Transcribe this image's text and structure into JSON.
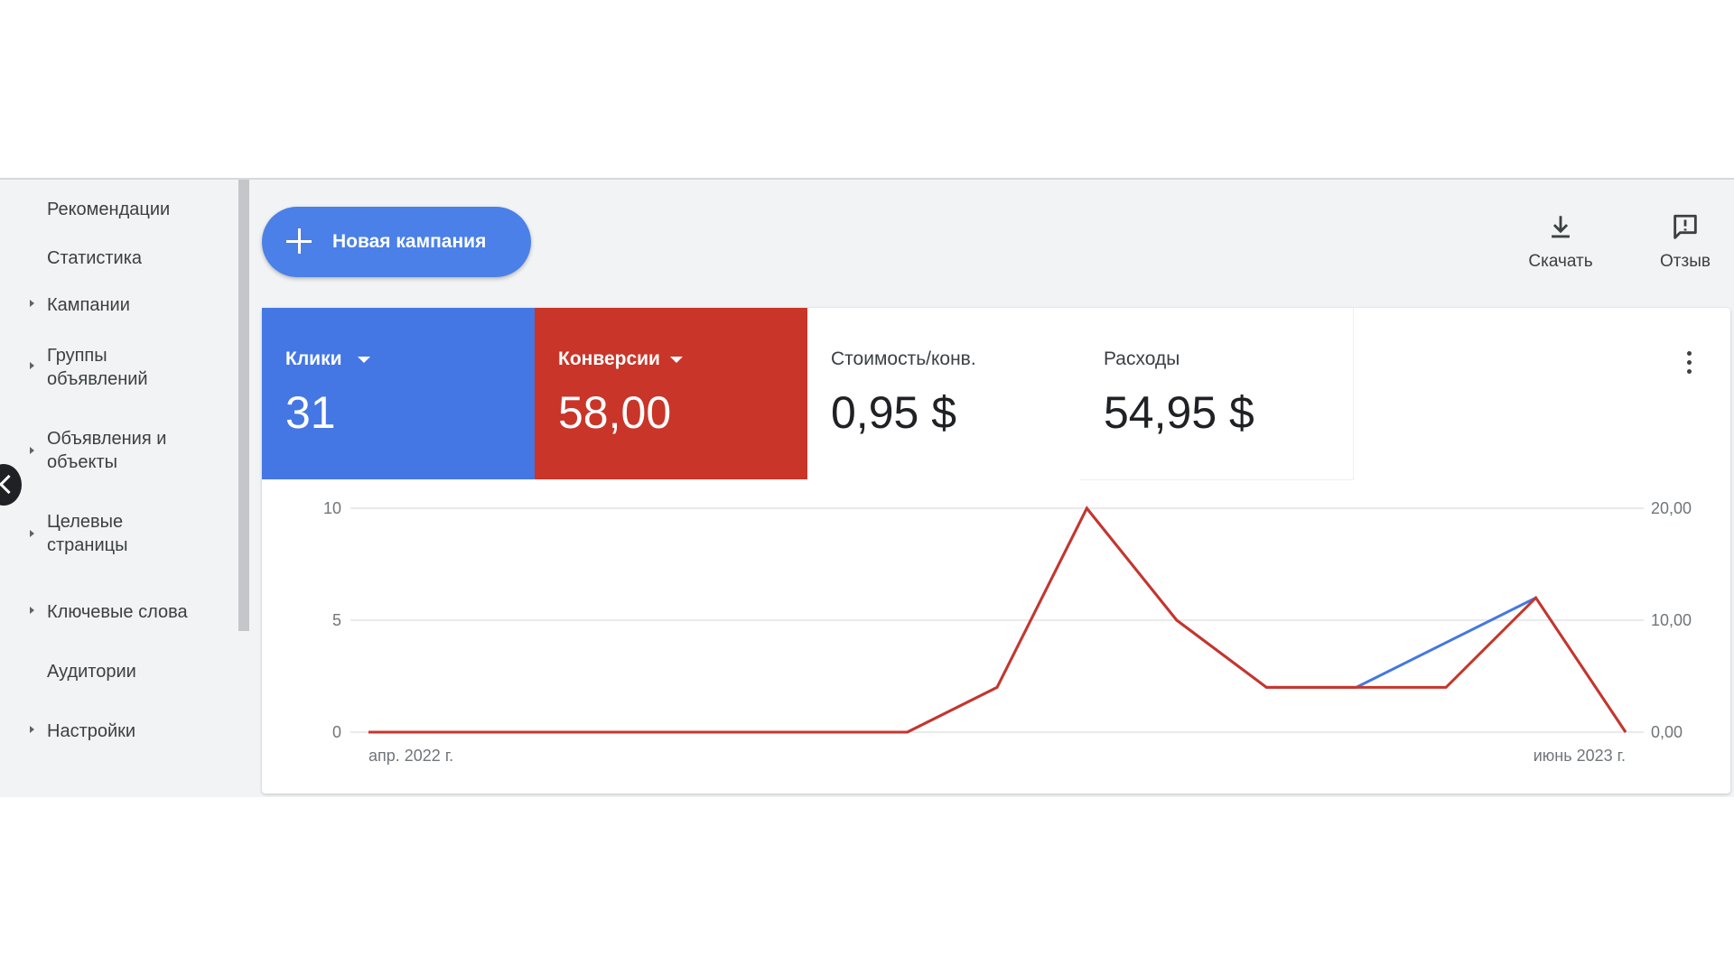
{
  "sidebar": {
    "items": [
      {
        "label": "Рекомендации",
        "expandable": false
      },
      {
        "label": "Статистика",
        "expandable": false
      },
      {
        "label": "Кампании",
        "expandable": true
      },
      {
        "label": "Группы\nобъявлений",
        "expandable": true
      },
      {
        "label": "Объявления и\nобъекты",
        "expandable": true
      },
      {
        "label": "Целевые\nстраницы",
        "expandable": true
      },
      {
        "label": "Ключевые слова",
        "expandable": true
      },
      {
        "label": "Аудитории",
        "expandable": false
      },
      {
        "label": "Настройки",
        "expandable": true
      }
    ]
  },
  "toolbar": {
    "new_campaign_label": "Новая кампания",
    "download_label": "Скачать",
    "feedback_label": "Отзыв"
  },
  "metrics": {
    "clicks": {
      "title": "Клики",
      "value": "31",
      "color": "#4477e3"
    },
    "conversions": {
      "title": "Конверсии",
      "value": "58,00",
      "color": "#c93529"
    },
    "cost_per_conv": {
      "title": "Стоимость/конв.",
      "value": "0,95 $"
    },
    "spend": {
      "title": "Расходы",
      "value": "54,95 $"
    }
  },
  "chart_data": {
    "type": "line",
    "x_start_label": "апр. 2022 г.",
    "x_end_label": "июнь 2023 г.",
    "left_axis": {
      "ticks": [
        "0",
        "5",
        "10"
      ],
      "ylim": [
        0,
        10
      ]
    },
    "right_axis": {
      "ticks": [
        "0,00",
        "10,00",
        "20,00"
      ],
      "ylim": [
        0,
        20
      ]
    },
    "grid": true,
    "series": [
      {
        "axis": "left",
        "color": "#4477e3",
        "values": [
          0,
          0,
          0,
          0,
          0,
          0,
          0,
          2,
          10,
          5,
          2,
          2,
          4,
          6,
          0
        ]
      },
      {
        "axis": "right",
        "color": "#c93529",
        "values": [
          0,
          0,
          0,
          0,
          0,
          0,
          0,
          4,
          20,
          10,
          4,
          4,
          4,
          12,
          0
        ]
      }
    ]
  }
}
